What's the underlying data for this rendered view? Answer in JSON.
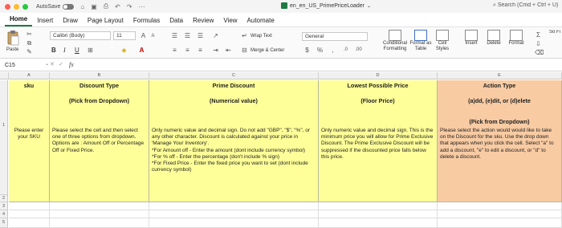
{
  "titlebar": {
    "autosave": "AutoSave",
    "document": "en_en_US_PrimePriceLoader",
    "search": "Search (Cmd + Ctrl + U)"
  },
  "tabs": [
    "Home",
    "Insert",
    "Draw",
    "Page Layout",
    "Formulas",
    "Data",
    "Review",
    "View",
    "Automate"
  ],
  "ribbon": {
    "paste": "Paste",
    "font": "Calibri (Body)",
    "font_size": "11",
    "bold": "B",
    "italic": "I",
    "underline": "U",
    "wrap_text": "Wrap Text",
    "merge_center": "Merge & Center",
    "number_format": "General",
    "conditional_formatting": "Conditional Formatting",
    "format_as_table": "Format as Table",
    "cell_styles": "Cell Styles",
    "insert": "Insert",
    "delete": "Delete",
    "format": "Format",
    "sort_filter": "So Fi"
  },
  "formula_bar": {
    "name_box": "C15",
    "fx": "fx",
    "value": ""
  },
  "sheet": {
    "columns": [
      "A",
      "B",
      "C",
      "D",
      "E"
    ],
    "rows": [
      "1",
      "2",
      "3",
      "4",
      "5"
    ],
    "headers": {
      "a": {
        "title": "sku",
        "sub": ""
      },
      "b": {
        "title": "Discount Type",
        "sub": "(Pick from Dropdown)"
      },
      "c": {
        "title": "Prime Discount",
        "sub": "(Numerical value)"
      },
      "d": {
        "title": "Lowest Possible Price",
        "sub": "(Floor Price)"
      },
      "e": {
        "title": "Action Type",
        "sub": "(a)dd, (e)dit, or (d)elete",
        "sub2": "(Pick from Dropdown)"
      }
    },
    "descriptions": {
      "a": "Please enter your SKU",
      "b": "Please select the cell and then select one of three options from dropdown. Options are : Amount Off or Percentage Off or Fixed Price.",
      "c": "Only numeric value and decimal sign. Do not add \"GBP\", \"$\", \"%\", or any other character. Discount is calculated against your price in 'Manage Your Inventory'.\n*For Amount off - Enter the amount (dont include currency symbol)\n*For % off -  Enter the percentage (don't include % sign)\n*For Fixed Price - Enter the fixed price you want to set (dont include currency symbol)",
      "d": "Only numeric value and decimal sign. This is the minimum price you will allow for Prime Exclusive Discount. The Prime Exclusive Discount will be suppressed if the discounted price falls below this price.",
      "e": "Please select the action would would like to take on the Discount for the sku. Use the drop down that appears when you click the cell. Select \"a\" to add a discount, \"e\" to edit a discount, or \"d\" to delete a discount."
    }
  },
  "colors": {
    "header_yellow": "#ffff99",
    "header_orange": "#f8cba3",
    "accent_green": "#1d7a43"
  }
}
